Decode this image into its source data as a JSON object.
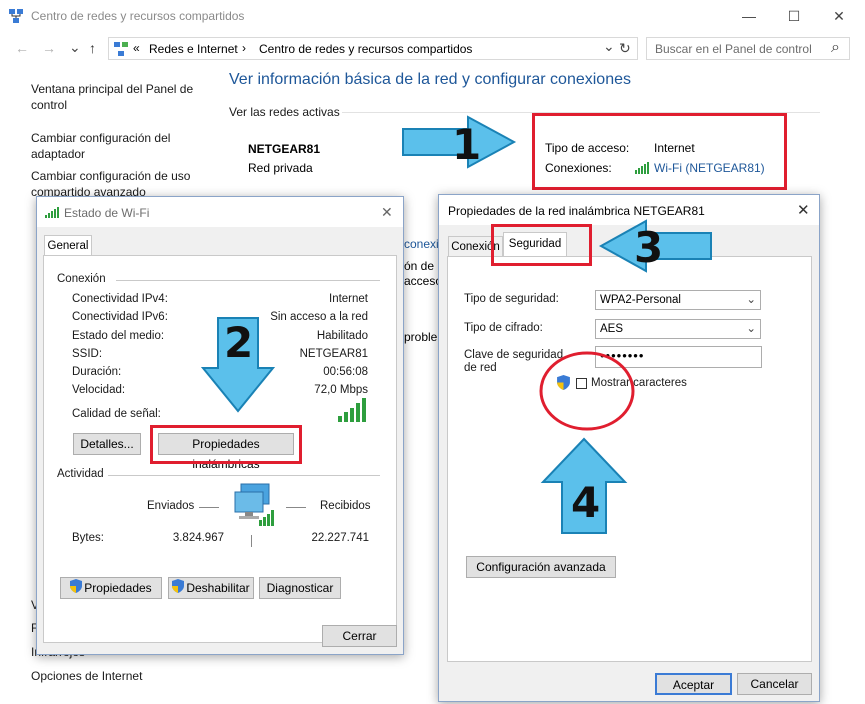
{
  "window": {
    "title": "Centro de redes y recursos compartidos",
    "minimize": "—",
    "maximize": "☐",
    "close": "✕"
  },
  "navigation": {
    "back": "←",
    "forward": "→",
    "up": "↑",
    "breadcrumb_prefix": "«",
    "breadcrumb": [
      "Redes e Internet",
      "Centro de redes y recursos compartidos"
    ],
    "breadcrumb_sep": "›",
    "dropdown": "⌄",
    "refresh": "↻",
    "search_placeholder": "Buscar en el Panel de control",
    "search_icon": "⌕"
  },
  "sidebar": {
    "items": [
      {
        "label": "Ventana principal del Panel de control"
      },
      {
        "label": "Cambiar configuración del adaptador"
      },
      {
        "label": "Cambiar configuración de uso compartido avanzado"
      }
    ],
    "bottom_items": [
      {
        "label": "V"
      },
      {
        "label": "F"
      },
      {
        "label": "Infrarrojos"
      },
      {
        "label": "Opciones de Internet"
      }
    ]
  },
  "main": {
    "title": "Ver información básica de la red y configurar conexiones",
    "active_networks_heading": "Ver las redes activas",
    "network_name": "NETGEAR81",
    "network_type": "Red privada",
    "access_type_label": "Tipo de acceso:",
    "access_type_value": "Internet",
    "connections_label": "Conexiones:",
    "connections_value": "Wi-Fi (NETGEAR81)",
    "partial_texts": [
      "conexi",
      "ón de l",
      "acceso",
      "proble"
    ]
  },
  "wifi_status_dialog": {
    "title": "Estado de Wi-Fi",
    "close": "✕",
    "tab": "General",
    "connection_heading": "Conexión",
    "rows": [
      {
        "label": "Conectividad IPv4:",
        "value": "Internet"
      },
      {
        "label": "Conectividad IPv6:",
        "value": "Sin acceso a la red"
      },
      {
        "label": "Estado del medio:",
        "value": "Habilitado"
      },
      {
        "label": "SSID:",
        "value": "NETGEAR81"
      },
      {
        "label": "Duración:",
        "value": "00:56:08"
      },
      {
        "label": "Velocidad:",
        "value": "72,0 Mbps"
      }
    ],
    "signal_label": "Calidad de señal:",
    "details_button": "Detalles...",
    "wireless_props_button": "Propiedades inalámbricas",
    "activity_heading": "Actividad",
    "sent_label": "Enviados",
    "received_label": "Recibidos",
    "bytes_label": "Bytes:",
    "bytes_sent": "3.824.967",
    "bytes_received": "22.227.741",
    "properties_button": "Propiedades",
    "disable_button": "Deshabilitar",
    "diagnose_button": "Diagnosticar",
    "close_button": "Cerrar"
  },
  "wireless_props_dialog": {
    "title": "Propiedades de la red inalámbrica NETGEAR81",
    "close": "✕",
    "tabs": [
      "Conexión",
      "Seguridad"
    ],
    "security_type_label": "Tipo de seguridad:",
    "security_type_value": "WPA2-Personal",
    "encryption_label": "Tipo de cifrado:",
    "encryption_value": "AES",
    "key_label": "Clave de seguridad de red",
    "key_value": "••••••••",
    "show_chars_label": "Mostrar caracteres",
    "advanced_button": "Configuración avanzada",
    "accept_button": "Aceptar",
    "cancel_button": "Cancelar"
  },
  "annotations": {
    "step1": "1",
    "step2": "2",
    "step3": "3",
    "step4": "4",
    "arrow_color": "#5bc0eb",
    "red_color": "#e01e2f"
  }
}
